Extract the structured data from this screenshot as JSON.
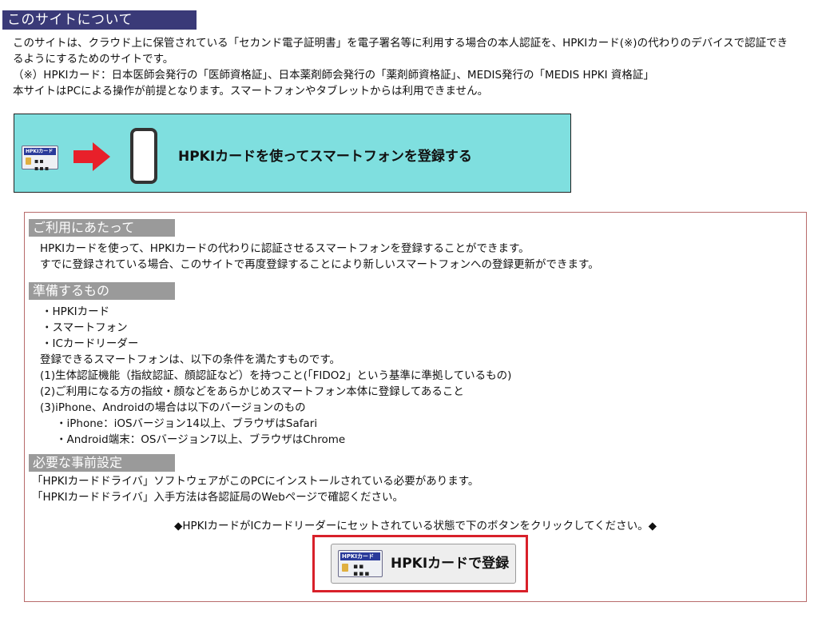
{
  "about": {
    "heading": "このサイトについて",
    "lines": [
      "このサイトは、クラウド上に保管されている「セカンド電子証明書」を電子署名等に利用する場合の本人認証を、HPKIカード(※)の代わりのデバイスで認証でき",
      "るようにするためのサイトです。",
      "（※）HPKIカード：日本医師会発行の「医師資格証」、日本薬剤師会発行の「薬剤師資格証」、MEDIS発行の「MEDIS HPKI 資格証」",
      "本サイトはPCによる操作が前提となります。スマートフォンやタブレットからは利用できません。"
    ]
  },
  "register_banner": {
    "label": "HPKIカードを使ってスマートフォンを登録する",
    "card_label": "HPKIカード"
  },
  "usage": {
    "heading": "ご利用にあたって",
    "lines": [
      "HPKIカードを使って、HPKIカードの代わりに認証させるスマートフォンを登録することができます。",
      "すでに登録されている場合、このサイトで再度登録することにより新しいスマートフォンへの登録更新ができます。"
    ]
  },
  "prepare": {
    "heading": "準備するもの",
    "items": [
      "・HPKIカード",
      "・スマートフォン",
      "・ICカードリーダー"
    ],
    "conditions_intro": "登録できるスマートフォンは、以下の条件を満たすものです。",
    "conditions": [
      "(1)生体認証機能（指紋認証、顔認証など）を持つこと(「FIDO2」という基準に準拠しているもの)",
      "(2)ご利用になる方の指紋・顔などをあらかじめスマートフォン本体に登録してあること",
      "(3)iPhone、Androidの場合は以下のバージョンのもの"
    ],
    "versions": [
      "・iPhone：iOSバージョン14以上、ブラウザはSafari",
      "・Android端末：OSバージョン7以上、ブラウザはChrome"
    ]
  },
  "setup": {
    "heading": "必要な事前設定",
    "lines": [
      "「HPKIカードドライバ」ソフトウェアがこのPCにインストールされている必要があります。",
      "「HPKIカードドライバ」入手方法は各認証局のWebページで確認ください。"
    ]
  },
  "instruction": "◆HPKIカードがICカードリーダーにセットされている状態で下のボタンをクリックしてください。◆",
  "register_button": {
    "label": "HPKIカードで登録",
    "card_label": "HPKIカード"
  },
  "colors": {
    "heading_bg": "#3a3a78",
    "banner_bg": "#7fdfdf",
    "section_bg": "#9a9a9a",
    "highlight": "#d8202a",
    "arrow": "#e8202a"
  }
}
